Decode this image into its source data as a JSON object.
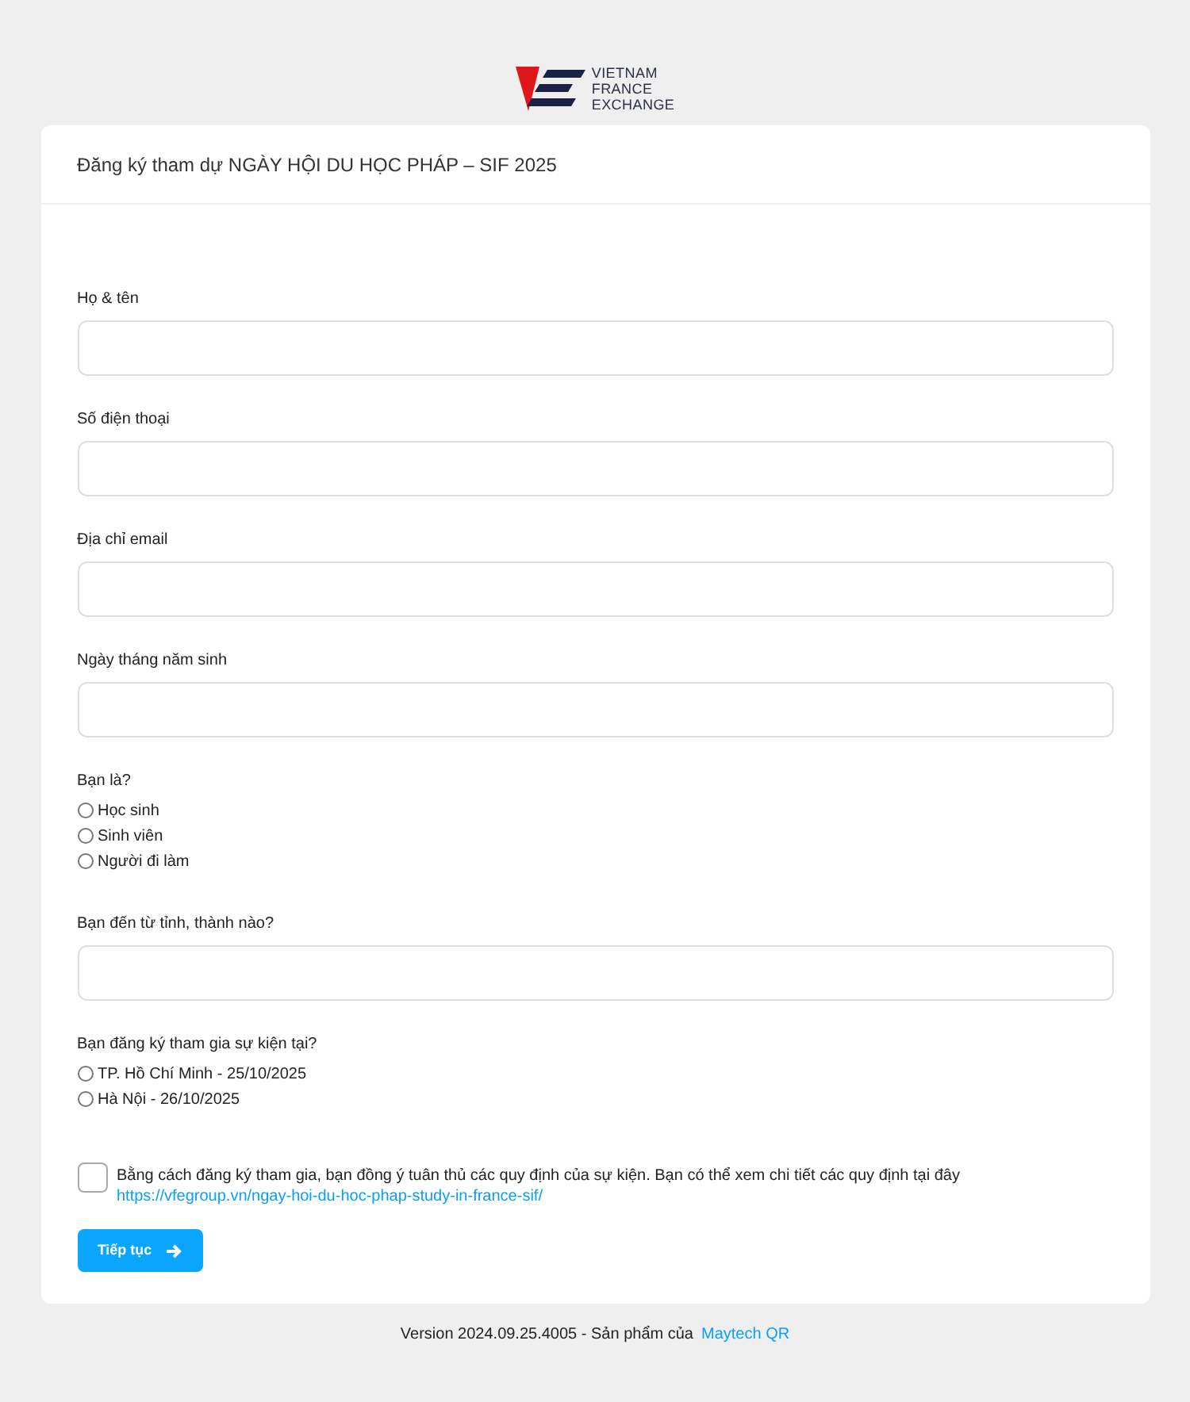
{
  "logo": {
    "lines": [
      "VIETNAM",
      "FRANCE",
      "EXCHANGE"
    ]
  },
  "form": {
    "title": "Đăng ký tham dự NGÀY HỘI DU HỌC PHÁP – SIF 2025",
    "fields": [
      {
        "kind": "text",
        "label": "Họ & tên"
      },
      {
        "kind": "text",
        "label": "Số điện thoại"
      },
      {
        "kind": "text",
        "label": "Địa chỉ email"
      },
      {
        "kind": "text",
        "label": "Ngày tháng năm sinh"
      },
      {
        "kind": "radio",
        "label": "Bạn là?",
        "options": [
          {
            "label": "Học sinh",
            "selected": false
          },
          {
            "label": "Sinh viên",
            "selected": false
          },
          {
            "label": "Người đi làm",
            "selected": false
          }
        ]
      },
      {
        "kind": "text",
        "label": "Bạn đến từ tỉnh, thành nào?"
      },
      {
        "kind": "radio",
        "label": "Bạn đăng ký tham gia sự kiện tại?",
        "options": [
          {
            "label": "TP. Hồ Chí Minh - 25/10/2025",
            "selected": false
          },
          {
            "label": "Hà Nội - 26/10/2025",
            "selected": false
          }
        ]
      }
    ],
    "consent": {
      "checked": false,
      "text": "Bằng cách đăng ký tham gia, bạn đồng ý tuân thủ các quy định của sự kiện. Bạn có thể xem chi tiết các quy định tại đây",
      "link": "https://vfegroup.vn/ngay-hoi-du-hoc-phap-study-in-france-sif/"
    },
    "submit": "Tiếp tục"
  },
  "footer": {
    "text": "Version 2024.09.25.4005 - Sản phẩm của",
    "link": "Maytech QR"
  }
}
